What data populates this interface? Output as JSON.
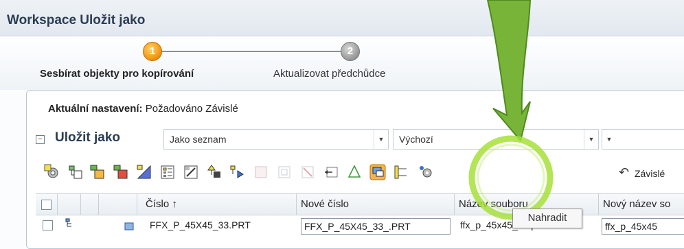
{
  "window": {
    "title": "Workspace Uložit jako"
  },
  "steps": [
    {
      "number": "1",
      "label": "Sesbírat objekty pro kopírování",
      "state": "active"
    },
    {
      "number": "2",
      "label": "Aktualizovat předchůdce",
      "state": "inactive"
    }
  ],
  "settings": {
    "label": "Aktuální nastavení:",
    "value": "Požadováno Závislé"
  },
  "group": {
    "toggle": "−",
    "title": "Uložit jako",
    "view_select": "Jako seznam",
    "default_select": "Výchozí"
  },
  "toolbar": {
    "icons": [
      "add-assembly-icon",
      "tree-view-icon",
      "add-green-icon",
      "add-green-2-icon",
      "triangle-icon",
      "list-icon",
      "edit-icon",
      "expand-up-icon",
      "expand-right-icon",
      "blank-disabled-icon",
      "frame-disabled-icon",
      "delete-disabled-icon",
      "rename-icon",
      "recycle-icon",
      "replace-icon",
      "tree-branch-icon",
      "settings-gear-icon"
    ],
    "dependents_label": "Závislé",
    "dependents_symbol": "↶"
  },
  "table": {
    "columns": [
      "",
      "",
      "",
      "",
      "Číslo ↑",
      "Nové číslo",
      "Název souboru",
      "Nový název so"
    ],
    "rows": [
      {
        "number": "FFX_P_45X45_33.PRT",
        "new_number": "FFX_P_45X45_33_.PRT",
        "filename": "ffx_p_45x45_33.prt",
        "new_filename": "ffx_p_45x45"
      }
    ]
  },
  "tooltip": {
    "text": "Nahradit"
  },
  "colors": {
    "accent_green": "#7cb83a",
    "highlight_green": "#a6e03a",
    "step_active": "#f39a12"
  }
}
